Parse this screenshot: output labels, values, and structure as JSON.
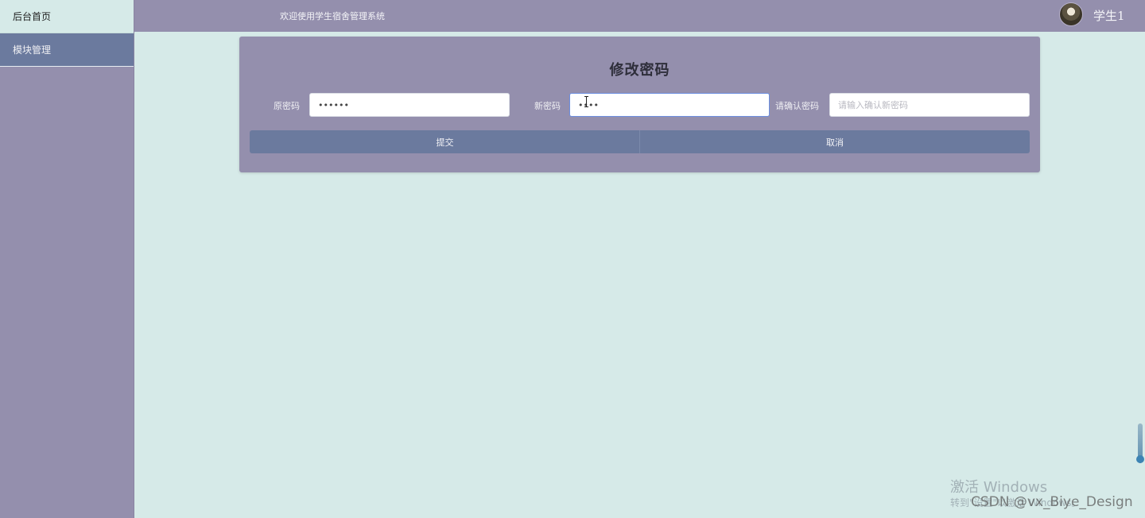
{
  "sidebar": {
    "items": [
      {
        "label": "后台首页"
      },
      {
        "label": "模块管理"
      }
    ]
  },
  "header": {
    "welcome": "欢迎使用学生宿舍管理系统",
    "username": "学生1"
  },
  "form": {
    "title": "修改密码",
    "old_password": {
      "label": "原密码",
      "value": "••••••"
    },
    "new_password": {
      "label": "新密码",
      "value": "••••"
    },
    "confirm_password": {
      "label": "请确认密码",
      "value": "",
      "placeholder": "请输入确认新密码"
    },
    "submit_label": "提交",
    "cancel_label": "取消"
  },
  "watermarks": {
    "activate_title": "激活 Windows",
    "activate_sub": "转到\"设置\"以激活 Windows。",
    "csdn": "CSDN @vx_Biye_Design"
  },
  "colors": {
    "background": "#d6eae8",
    "panel": "#948fad",
    "accent": "#6b7a9e",
    "focus_border": "#6d8fe0"
  }
}
